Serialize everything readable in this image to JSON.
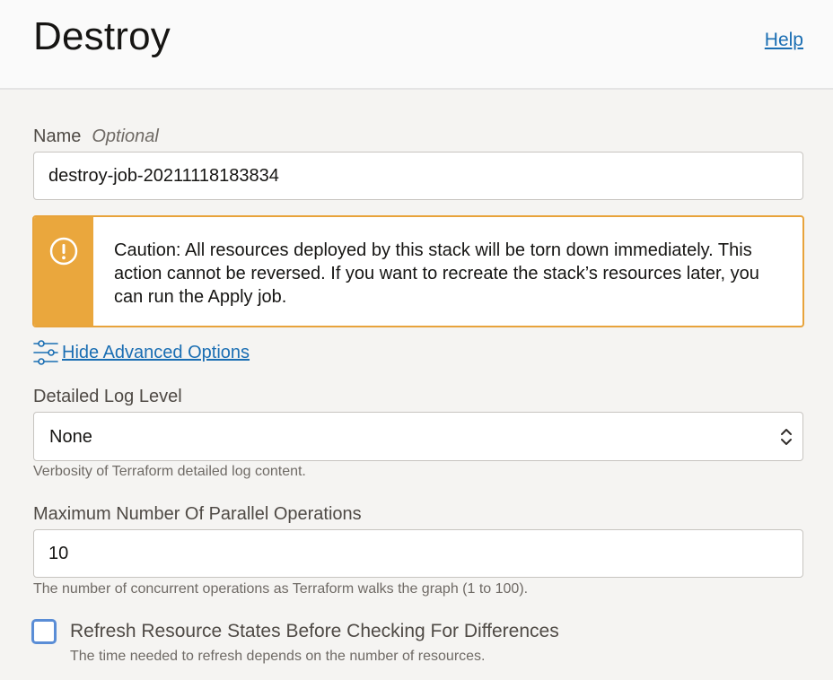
{
  "header": {
    "title": "Destroy",
    "help_label": "Help"
  },
  "name_field": {
    "label": "Name",
    "optional_label": "Optional",
    "value": "destroy-job-20211118183834"
  },
  "caution": {
    "text": "Caution: All resources deployed by this stack will be torn down immediately. This action cannot be reversed. If you want to recreate the stack’s resources later, you can run the Apply job.",
    "accent_color": "#eaa73d",
    "icon": "exclamation-circle-icon"
  },
  "advanced_toggle": {
    "label": "Hide Advanced Options",
    "icon": "sliders-icon"
  },
  "log_level": {
    "label": "Detailed Log Level",
    "selected": "None",
    "hint": "Verbosity of Terraform detailed log content."
  },
  "parallel_ops": {
    "label": "Maximum Number Of Parallel Operations",
    "value": "10",
    "hint": "The number of concurrent operations as Terraform walks the graph (1 to 100)."
  },
  "refresh_option": {
    "label": "Refresh Resource States Before Checking For Differences",
    "hint": "The time needed to refresh depends on the number of resources.",
    "checked": false
  },
  "colors": {
    "link": "#1a6eb3",
    "checkbox_focus": "#5a8dd6"
  }
}
